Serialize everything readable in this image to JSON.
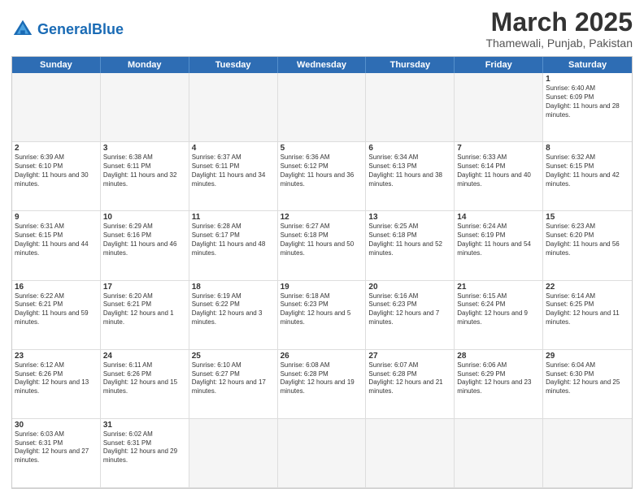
{
  "header": {
    "logo_general": "General",
    "logo_blue": "Blue",
    "month_year": "March 2025",
    "location": "Thamewali, Punjab, Pakistan"
  },
  "days": [
    "Sunday",
    "Monday",
    "Tuesday",
    "Wednesday",
    "Thursday",
    "Friday",
    "Saturday"
  ],
  "cells": [
    {
      "day": null,
      "empty": true
    },
    {
      "day": null,
      "empty": true
    },
    {
      "day": null,
      "empty": true
    },
    {
      "day": null,
      "empty": true
    },
    {
      "day": null,
      "empty": true
    },
    {
      "day": null,
      "empty": true
    },
    {
      "day": 1,
      "sunrise": "6:40 AM",
      "sunset": "6:09 PM",
      "daylight": "11 hours and 28 minutes."
    },
    {
      "day": 2,
      "sunrise": "6:39 AM",
      "sunset": "6:10 PM",
      "daylight": "11 hours and 30 minutes."
    },
    {
      "day": 3,
      "sunrise": "6:38 AM",
      "sunset": "6:11 PM",
      "daylight": "11 hours and 32 minutes."
    },
    {
      "day": 4,
      "sunrise": "6:37 AM",
      "sunset": "6:11 PM",
      "daylight": "11 hours and 34 minutes."
    },
    {
      "day": 5,
      "sunrise": "6:36 AM",
      "sunset": "6:12 PM",
      "daylight": "11 hours and 36 minutes."
    },
    {
      "day": 6,
      "sunrise": "6:34 AM",
      "sunset": "6:13 PM",
      "daylight": "11 hours and 38 minutes."
    },
    {
      "day": 7,
      "sunrise": "6:33 AM",
      "sunset": "6:14 PM",
      "daylight": "11 hours and 40 minutes."
    },
    {
      "day": 8,
      "sunrise": "6:32 AM",
      "sunset": "6:15 PM",
      "daylight": "11 hours and 42 minutes."
    },
    {
      "day": 9,
      "sunrise": "6:31 AM",
      "sunset": "6:15 PM",
      "daylight": "11 hours and 44 minutes."
    },
    {
      "day": 10,
      "sunrise": "6:29 AM",
      "sunset": "6:16 PM",
      "daylight": "11 hours and 46 minutes."
    },
    {
      "day": 11,
      "sunrise": "6:28 AM",
      "sunset": "6:17 PM",
      "daylight": "11 hours and 48 minutes."
    },
    {
      "day": 12,
      "sunrise": "6:27 AM",
      "sunset": "6:18 PM",
      "daylight": "11 hours and 50 minutes."
    },
    {
      "day": 13,
      "sunrise": "6:25 AM",
      "sunset": "6:18 PM",
      "daylight": "11 hours and 52 minutes."
    },
    {
      "day": 14,
      "sunrise": "6:24 AM",
      "sunset": "6:19 PM",
      "daylight": "11 hours and 54 minutes."
    },
    {
      "day": 15,
      "sunrise": "6:23 AM",
      "sunset": "6:20 PM",
      "daylight": "11 hours and 56 minutes."
    },
    {
      "day": 16,
      "sunrise": "6:22 AM",
      "sunset": "6:21 PM",
      "daylight": "11 hours and 59 minutes."
    },
    {
      "day": 17,
      "sunrise": "6:20 AM",
      "sunset": "6:21 PM",
      "daylight": "12 hours and 1 minute."
    },
    {
      "day": 18,
      "sunrise": "6:19 AM",
      "sunset": "6:22 PM",
      "daylight": "12 hours and 3 minutes."
    },
    {
      "day": 19,
      "sunrise": "6:18 AM",
      "sunset": "6:23 PM",
      "daylight": "12 hours and 5 minutes."
    },
    {
      "day": 20,
      "sunrise": "6:16 AM",
      "sunset": "6:23 PM",
      "daylight": "12 hours and 7 minutes."
    },
    {
      "day": 21,
      "sunrise": "6:15 AM",
      "sunset": "6:24 PM",
      "daylight": "12 hours and 9 minutes."
    },
    {
      "day": 22,
      "sunrise": "6:14 AM",
      "sunset": "6:25 PM",
      "daylight": "12 hours and 11 minutes."
    },
    {
      "day": 23,
      "sunrise": "6:12 AM",
      "sunset": "6:26 PM",
      "daylight": "12 hours and 13 minutes."
    },
    {
      "day": 24,
      "sunrise": "6:11 AM",
      "sunset": "6:26 PM",
      "daylight": "12 hours and 15 minutes."
    },
    {
      "day": 25,
      "sunrise": "6:10 AM",
      "sunset": "6:27 PM",
      "daylight": "12 hours and 17 minutes."
    },
    {
      "day": 26,
      "sunrise": "6:08 AM",
      "sunset": "6:28 PM",
      "daylight": "12 hours and 19 minutes."
    },
    {
      "day": 27,
      "sunrise": "6:07 AM",
      "sunset": "6:28 PM",
      "daylight": "12 hours and 21 minutes."
    },
    {
      "day": 28,
      "sunrise": "6:06 AM",
      "sunset": "6:29 PM",
      "daylight": "12 hours and 23 minutes."
    },
    {
      "day": 29,
      "sunrise": "6:04 AM",
      "sunset": "6:30 PM",
      "daylight": "12 hours and 25 minutes."
    },
    {
      "day": 30,
      "sunrise": "6:03 AM",
      "sunset": "6:31 PM",
      "daylight": "12 hours and 27 minutes."
    },
    {
      "day": 31,
      "sunrise": "6:02 AM",
      "sunset": "6:31 PM",
      "daylight": "12 hours and 29 minutes."
    },
    {
      "day": null,
      "empty": true
    },
    {
      "day": null,
      "empty": true
    },
    {
      "day": null,
      "empty": true
    },
    {
      "day": null,
      "empty": true
    },
    {
      "day": null,
      "empty": true
    }
  ]
}
